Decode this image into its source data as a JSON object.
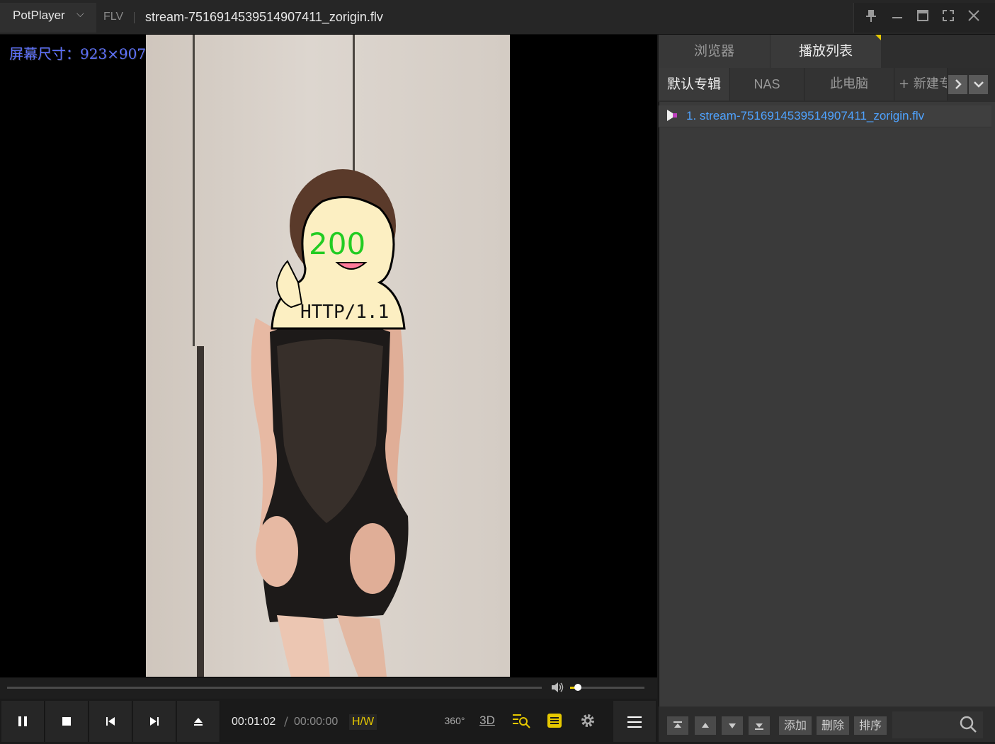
{
  "titlebar": {
    "app_name": "PotPlayer",
    "app_caret": "⌵",
    "format": "FLV",
    "file_name": "stream-7516914539514907411_zorigin.flv",
    "buttons": {
      "pin": "📌",
      "minimize": "—",
      "maximize": "☐",
      "fullscreen": "⛶",
      "close": "✕"
    }
  },
  "video": {
    "osd_text": "屏幕尺寸：923×907",
    "sticker_top": "200",
    "sticker_bottom": "HTTP/1.1"
  },
  "controls": {
    "time_current": "00:01:02",
    "time_separator": "/",
    "time_total": "00:00:00",
    "aspect_label": "H/W",
    "icon_360": "360°",
    "icon_3d": "3D",
    "volume_level": 0.1
  },
  "panel": {
    "tabs": [
      {
        "label": "浏览器"
      },
      {
        "label": "播放列表"
      }
    ],
    "subtabs": [
      {
        "label": "默认专辑"
      },
      {
        "label": "NAS"
      },
      {
        "label": "此电脑"
      },
      {
        "label": "+ 新建专辑"
      }
    ],
    "playlist": [
      {
        "label": "1. stream-7516914539514907411_zorigin.flv"
      }
    ],
    "bottom_buttons": [
      {
        "label": "添加"
      },
      {
        "label": "删除"
      },
      {
        "label": "排序"
      }
    ]
  },
  "colors": {
    "accent": "#e6c800",
    "link": "#4fa3ff",
    "osd": "#5f73ff"
  }
}
